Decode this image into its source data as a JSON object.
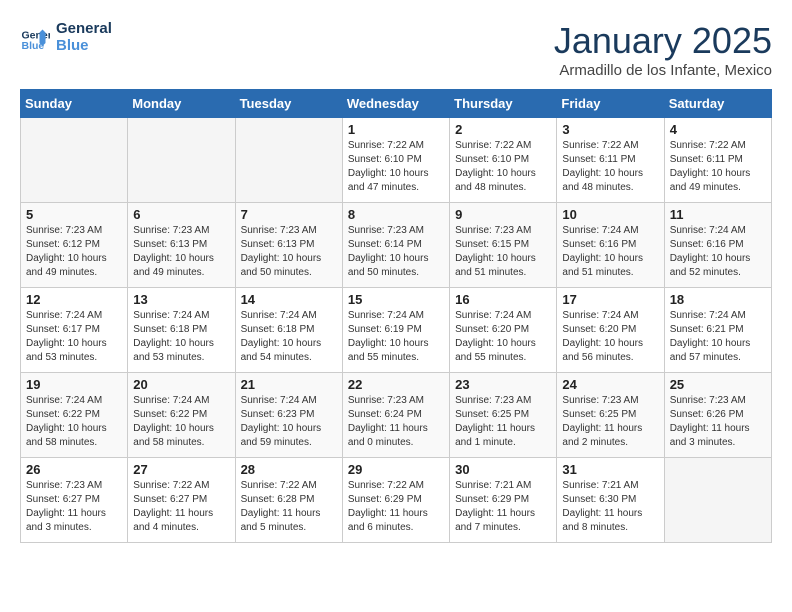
{
  "header": {
    "logo_line1": "General",
    "logo_line2": "Blue",
    "month": "January 2025",
    "location": "Armadillo de los Infante, Mexico"
  },
  "days_of_week": [
    "Sunday",
    "Monday",
    "Tuesday",
    "Wednesday",
    "Thursday",
    "Friday",
    "Saturday"
  ],
  "weeks": [
    [
      {
        "day": "",
        "sunrise": "",
        "sunset": "",
        "daylight": ""
      },
      {
        "day": "",
        "sunrise": "",
        "sunset": "",
        "daylight": ""
      },
      {
        "day": "",
        "sunrise": "",
        "sunset": "",
        "daylight": ""
      },
      {
        "day": "1",
        "sunrise": "Sunrise: 7:22 AM",
        "sunset": "Sunset: 6:10 PM",
        "daylight": "Daylight: 10 hours and 47 minutes."
      },
      {
        "day": "2",
        "sunrise": "Sunrise: 7:22 AM",
        "sunset": "Sunset: 6:10 PM",
        "daylight": "Daylight: 10 hours and 48 minutes."
      },
      {
        "day": "3",
        "sunrise": "Sunrise: 7:22 AM",
        "sunset": "Sunset: 6:11 PM",
        "daylight": "Daylight: 10 hours and 48 minutes."
      },
      {
        "day": "4",
        "sunrise": "Sunrise: 7:22 AM",
        "sunset": "Sunset: 6:11 PM",
        "daylight": "Daylight: 10 hours and 49 minutes."
      }
    ],
    [
      {
        "day": "5",
        "sunrise": "Sunrise: 7:23 AM",
        "sunset": "Sunset: 6:12 PM",
        "daylight": "Daylight: 10 hours and 49 minutes."
      },
      {
        "day": "6",
        "sunrise": "Sunrise: 7:23 AM",
        "sunset": "Sunset: 6:13 PM",
        "daylight": "Daylight: 10 hours and 49 minutes."
      },
      {
        "day": "7",
        "sunrise": "Sunrise: 7:23 AM",
        "sunset": "Sunset: 6:13 PM",
        "daylight": "Daylight: 10 hours and 50 minutes."
      },
      {
        "day": "8",
        "sunrise": "Sunrise: 7:23 AM",
        "sunset": "Sunset: 6:14 PM",
        "daylight": "Daylight: 10 hours and 50 minutes."
      },
      {
        "day": "9",
        "sunrise": "Sunrise: 7:23 AM",
        "sunset": "Sunset: 6:15 PM",
        "daylight": "Daylight: 10 hours and 51 minutes."
      },
      {
        "day": "10",
        "sunrise": "Sunrise: 7:24 AM",
        "sunset": "Sunset: 6:16 PM",
        "daylight": "Daylight: 10 hours and 51 minutes."
      },
      {
        "day": "11",
        "sunrise": "Sunrise: 7:24 AM",
        "sunset": "Sunset: 6:16 PM",
        "daylight": "Daylight: 10 hours and 52 minutes."
      }
    ],
    [
      {
        "day": "12",
        "sunrise": "Sunrise: 7:24 AM",
        "sunset": "Sunset: 6:17 PM",
        "daylight": "Daylight: 10 hours and 53 minutes."
      },
      {
        "day": "13",
        "sunrise": "Sunrise: 7:24 AM",
        "sunset": "Sunset: 6:18 PM",
        "daylight": "Daylight: 10 hours and 53 minutes."
      },
      {
        "day": "14",
        "sunrise": "Sunrise: 7:24 AM",
        "sunset": "Sunset: 6:18 PM",
        "daylight": "Daylight: 10 hours and 54 minutes."
      },
      {
        "day": "15",
        "sunrise": "Sunrise: 7:24 AM",
        "sunset": "Sunset: 6:19 PM",
        "daylight": "Daylight: 10 hours and 55 minutes."
      },
      {
        "day": "16",
        "sunrise": "Sunrise: 7:24 AM",
        "sunset": "Sunset: 6:20 PM",
        "daylight": "Daylight: 10 hours and 55 minutes."
      },
      {
        "day": "17",
        "sunrise": "Sunrise: 7:24 AM",
        "sunset": "Sunset: 6:20 PM",
        "daylight": "Daylight: 10 hours and 56 minutes."
      },
      {
        "day": "18",
        "sunrise": "Sunrise: 7:24 AM",
        "sunset": "Sunset: 6:21 PM",
        "daylight": "Daylight: 10 hours and 57 minutes."
      }
    ],
    [
      {
        "day": "19",
        "sunrise": "Sunrise: 7:24 AM",
        "sunset": "Sunset: 6:22 PM",
        "daylight": "Daylight: 10 hours and 58 minutes."
      },
      {
        "day": "20",
        "sunrise": "Sunrise: 7:24 AM",
        "sunset": "Sunset: 6:22 PM",
        "daylight": "Daylight: 10 hours and 58 minutes."
      },
      {
        "day": "21",
        "sunrise": "Sunrise: 7:24 AM",
        "sunset": "Sunset: 6:23 PM",
        "daylight": "Daylight: 10 hours and 59 minutes."
      },
      {
        "day": "22",
        "sunrise": "Sunrise: 7:23 AM",
        "sunset": "Sunset: 6:24 PM",
        "daylight": "Daylight: 11 hours and 0 minutes."
      },
      {
        "day": "23",
        "sunrise": "Sunrise: 7:23 AM",
        "sunset": "Sunset: 6:25 PM",
        "daylight": "Daylight: 11 hours and 1 minute."
      },
      {
        "day": "24",
        "sunrise": "Sunrise: 7:23 AM",
        "sunset": "Sunset: 6:25 PM",
        "daylight": "Daylight: 11 hours and 2 minutes."
      },
      {
        "day": "25",
        "sunrise": "Sunrise: 7:23 AM",
        "sunset": "Sunset: 6:26 PM",
        "daylight": "Daylight: 11 hours and 3 minutes."
      }
    ],
    [
      {
        "day": "26",
        "sunrise": "Sunrise: 7:23 AM",
        "sunset": "Sunset: 6:27 PM",
        "daylight": "Daylight: 11 hours and 3 minutes."
      },
      {
        "day": "27",
        "sunrise": "Sunrise: 7:22 AM",
        "sunset": "Sunset: 6:27 PM",
        "daylight": "Daylight: 11 hours and 4 minutes."
      },
      {
        "day": "28",
        "sunrise": "Sunrise: 7:22 AM",
        "sunset": "Sunset: 6:28 PM",
        "daylight": "Daylight: 11 hours and 5 minutes."
      },
      {
        "day": "29",
        "sunrise": "Sunrise: 7:22 AM",
        "sunset": "Sunset: 6:29 PM",
        "daylight": "Daylight: 11 hours and 6 minutes."
      },
      {
        "day": "30",
        "sunrise": "Sunrise: 7:21 AM",
        "sunset": "Sunset: 6:29 PM",
        "daylight": "Daylight: 11 hours and 7 minutes."
      },
      {
        "day": "31",
        "sunrise": "Sunrise: 7:21 AM",
        "sunset": "Sunset: 6:30 PM",
        "daylight": "Daylight: 11 hours and 8 minutes."
      },
      {
        "day": "",
        "sunrise": "",
        "sunset": "",
        "daylight": ""
      }
    ]
  ]
}
